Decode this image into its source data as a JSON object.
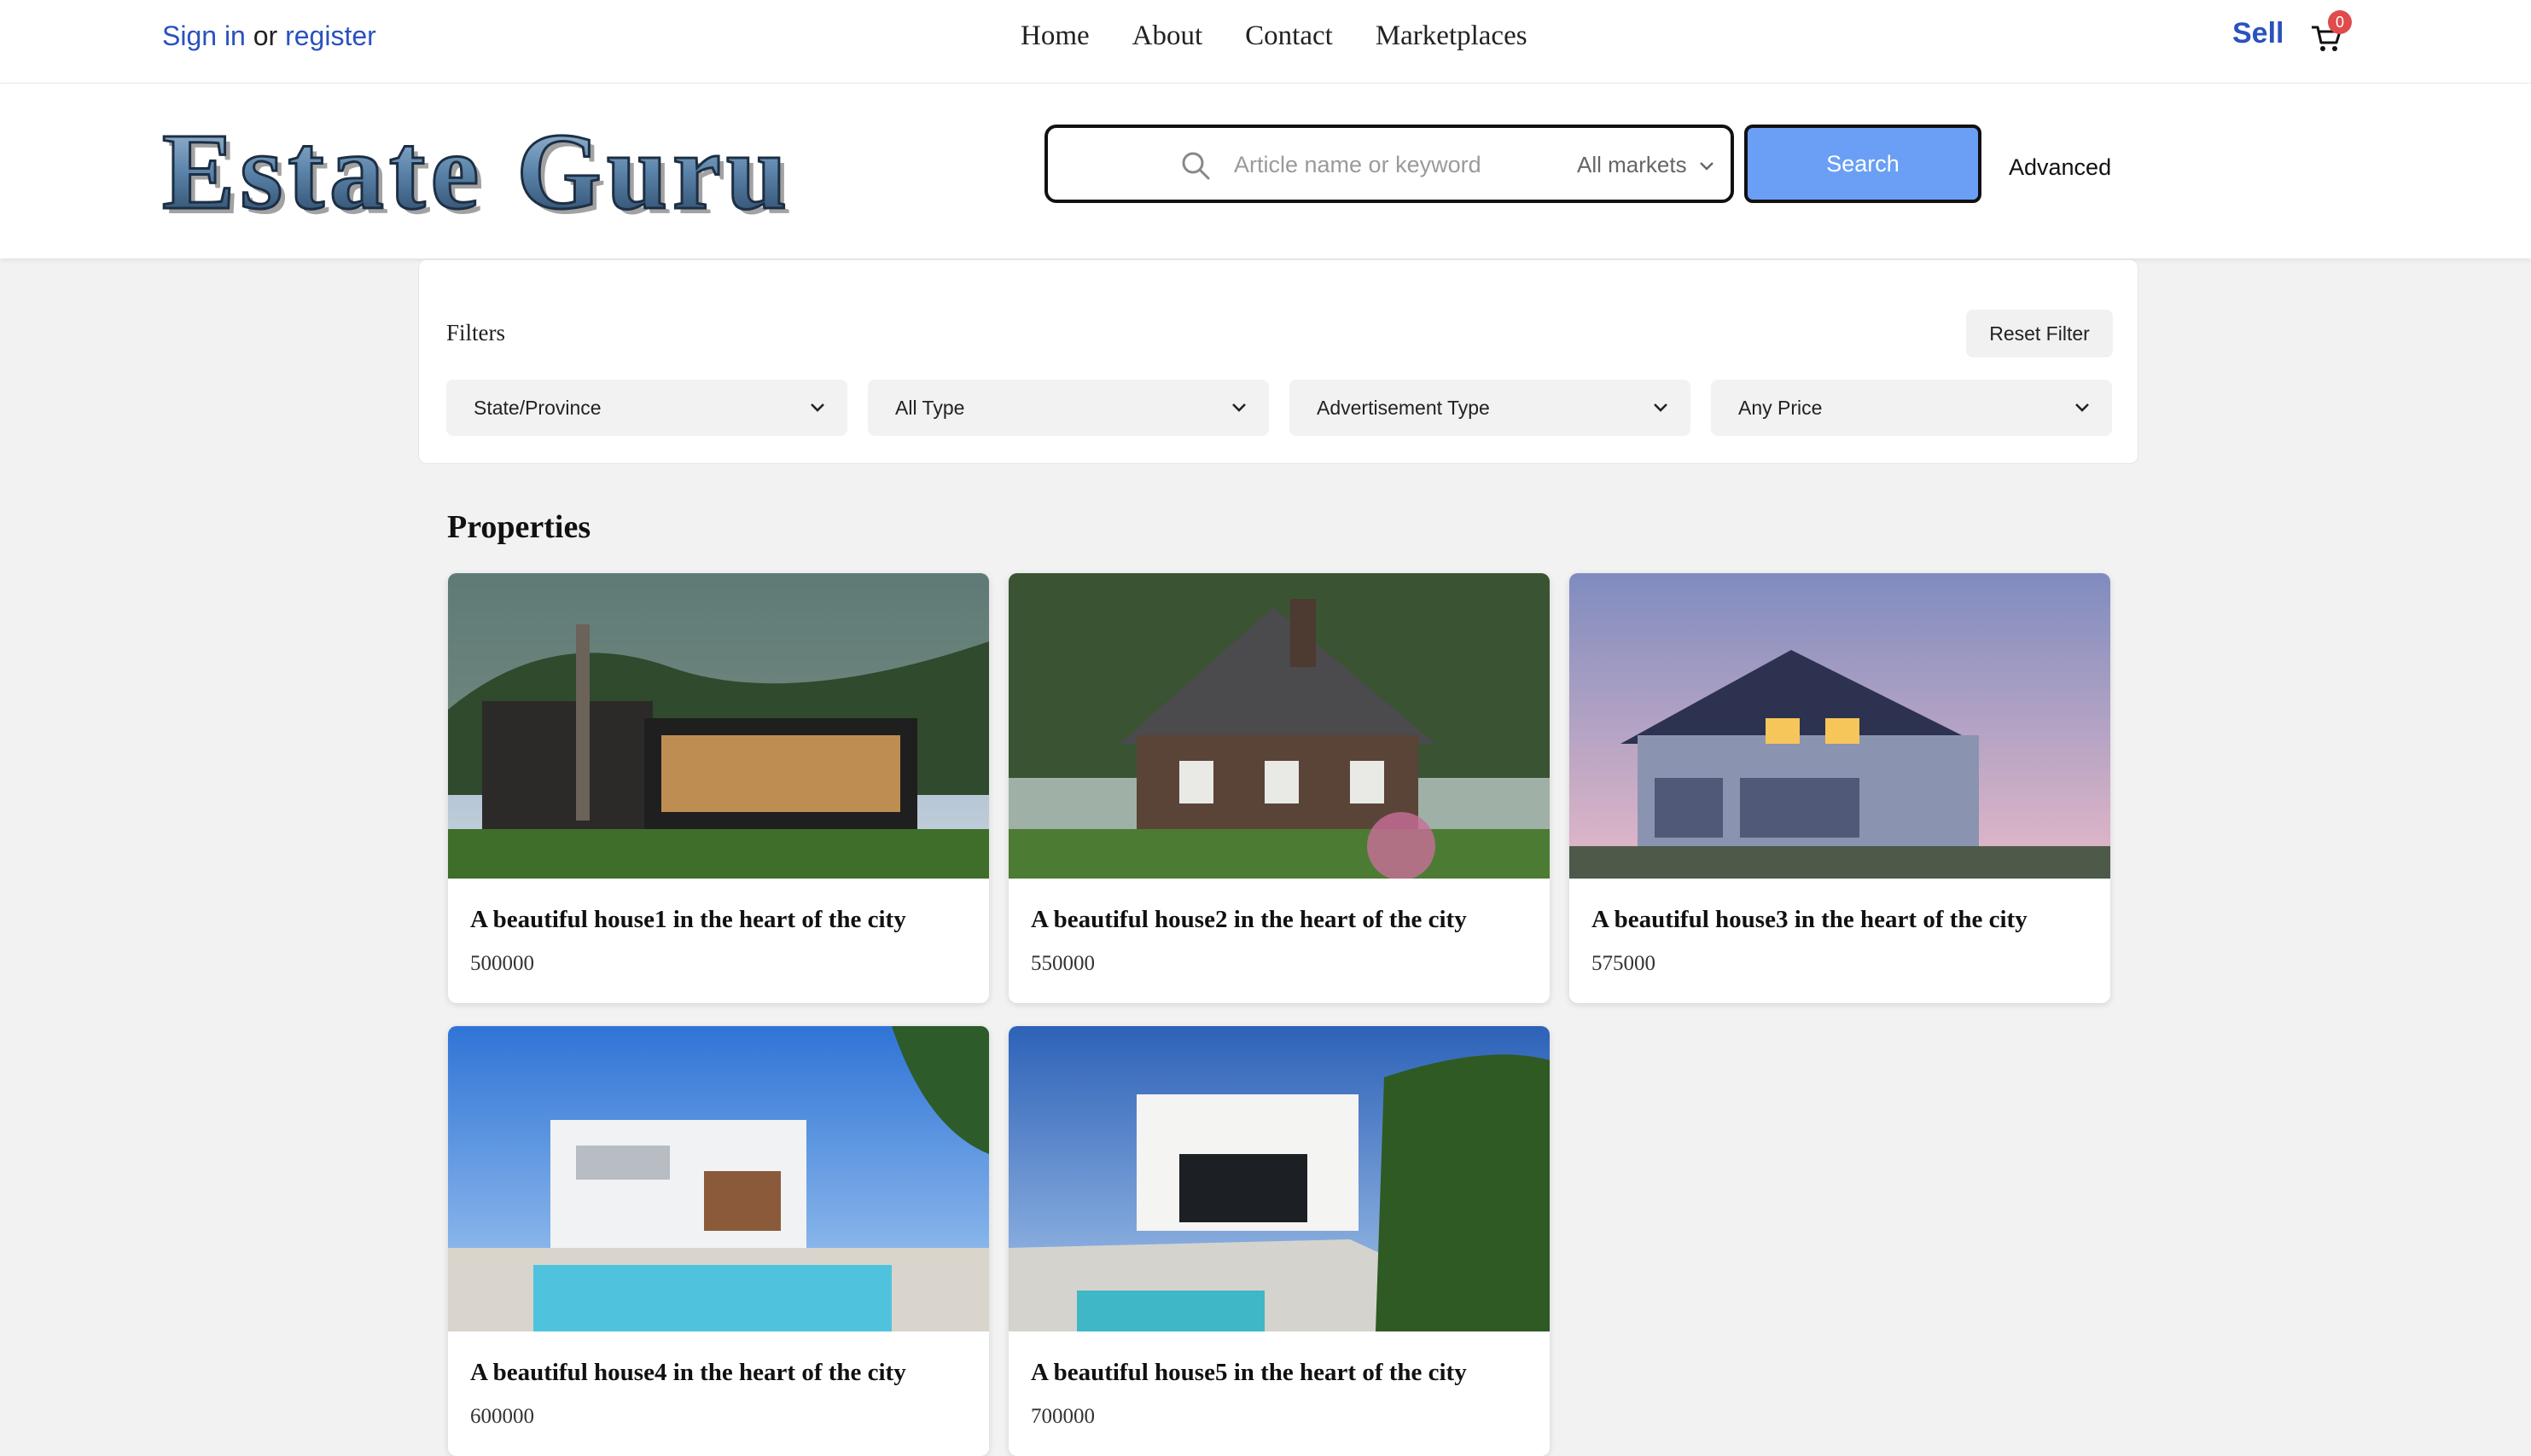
{
  "topbar": {
    "signin": "Sign in",
    "or": "or",
    "register": "register",
    "nav": [
      "Home",
      "About",
      "Contact",
      "Marketplaces"
    ],
    "sell": "Sell",
    "cart_count": "0",
    "cart_icon": "cart-icon"
  },
  "header": {
    "logo_text": "Estate Guru",
    "search": {
      "placeholder": "Article name or keyword",
      "market": "All markets",
      "button": "Search"
    },
    "advanced": "Advanced"
  },
  "filters": {
    "label": "Filters",
    "reset": "Reset Filter",
    "selects": [
      "State/Province",
      "All Type",
      "Advertisement Type",
      "Any Price"
    ]
  },
  "properties": {
    "title": "Properties",
    "items": [
      {
        "title": "A beautiful house1 in the heart of the city",
        "price": "500000"
      },
      {
        "title": "A beautiful house2 in the heart of the city",
        "price": "550000"
      },
      {
        "title": "A beautiful house3 in the heart of the city",
        "price": "575000"
      },
      {
        "title": "A beautiful house4 in the heart of the city",
        "price": "600000"
      },
      {
        "title": "A beautiful house5 in the heart of the city",
        "price": "700000"
      }
    ]
  }
}
